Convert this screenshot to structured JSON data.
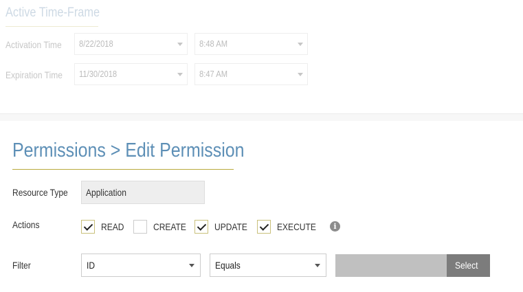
{
  "background_section": {
    "title": "Active Time-Frame",
    "activation": {
      "label": "Activation Time",
      "date": "8/22/2018",
      "time": "8:48 AM"
    },
    "expiration": {
      "label": "Expiration Time",
      "date": "11/30/2018",
      "time": "8:47 AM"
    }
  },
  "main": {
    "title": "Permissions > Edit Permission",
    "resource_type": {
      "label": "Resource Type",
      "value": "Application"
    },
    "actions": {
      "label": "Actions",
      "items": [
        {
          "label": "READ",
          "checked": true
        },
        {
          "label": "CREATE",
          "checked": false
        },
        {
          "label": "UPDATE",
          "checked": true
        },
        {
          "label": "EXECUTE",
          "checked": true
        }
      ],
      "info_icon": "info-icon"
    },
    "filter": {
      "label": "Filter",
      "field": "ID",
      "operator": "Equals",
      "value": "",
      "button_label": "Select"
    }
  },
  "colors": {
    "title_blue": "#5d8fb6",
    "underline_gold": "#b8a93c",
    "button_gray": "#7c7c7c"
  }
}
